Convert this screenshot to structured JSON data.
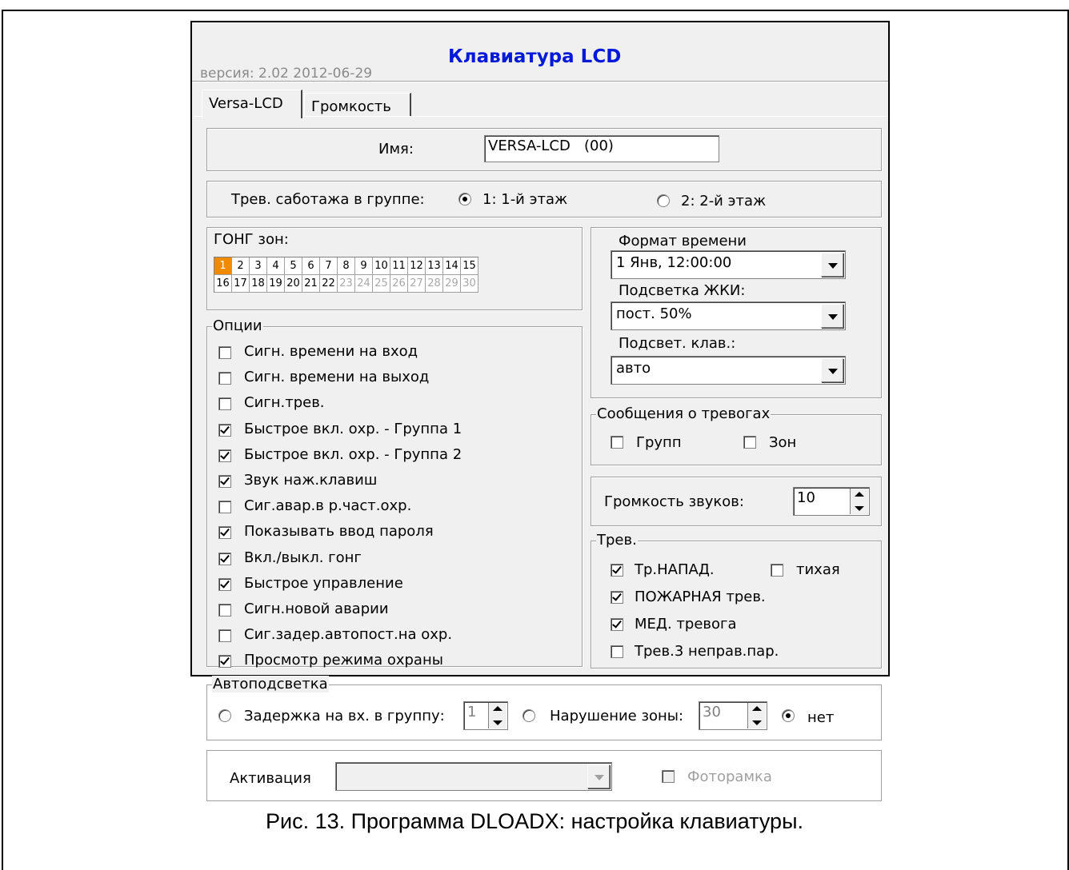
{
  "window": {
    "version": "версия: 2.02 2012-06-29",
    "title": "Клавиатура LCD",
    "tabs": [
      "Versa-LCD",
      "Громкость"
    ]
  },
  "name": {
    "label": "Имя:",
    "value": "VERSA-LCD   (00)"
  },
  "tamper": {
    "label": "Трев. саботажа в группе:",
    "option1": "1: 1-й этаж",
    "option2": "2: 2-й этаж",
    "selected": 1
  },
  "chime": {
    "title": "ГОНГ зон:",
    "zones": [
      "1",
      "2",
      "3",
      "4",
      "5",
      "6",
      "7",
      "8",
      "9",
      "10",
      "11",
      "12",
      "13",
      "14",
      "15",
      "16",
      "17",
      "18",
      "19",
      "20",
      "21",
      "22",
      "23",
      "24",
      "25",
      "26",
      "27",
      "28",
      "29",
      "30"
    ],
    "selected": "1",
    "enabled_max": 22
  },
  "options": {
    "title": "Опции",
    "items": [
      {
        "label": "Сигн. времени на вход",
        "checked": false
      },
      {
        "label": "Сигн. времени на выход",
        "checked": false
      },
      {
        "label": "Сигн.трев.",
        "checked": false
      },
      {
        "label": "Быстрое вкл. охр. - Группа 1",
        "checked": true
      },
      {
        "label": "Быстрое вкл. охр. - Группа 2",
        "checked": true
      },
      {
        "label": "Звук наж.клавиш",
        "checked": true
      },
      {
        "label": "Сиг.авар.в р.част.охр.",
        "checked": false
      },
      {
        "label": "Показывать ввод пароля",
        "checked": true
      },
      {
        "label": "Вкл./выкл. гонг",
        "checked": true
      },
      {
        "label": "Быстрое управление",
        "checked": true
      },
      {
        "label": "Сигн.новой аварии",
        "checked": false
      },
      {
        "label": "Сиг.задер.автопост.на охр.",
        "checked": false
      },
      {
        "label": "Просмотр режима охраны",
        "checked": true
      }
    ]
  },
  "format": {
    "time_label": "Формат времени",
    "time_value": "1 Янв, 12:00:00",
    "lcd_label": "Подсветка ЖКИ:",
    "lcd_value": "пост. 50%",
    "keys_label": "Подсвет. клав.:",
    "keys_value": "авто"
  },
  "alarm_msgs": {
    "title": "Сообщения о тревогах",
    "groups": "Групп",
    "zones": "Зон"
  },
  "volume": {
    "label": "Громкость звуков:",
    "value": "10"
  },
  "alarms": {
    "title": "Трев.",
    "panic": "Тр.НАПАД.",
    "silent": "тихая",
    "fire": "ПОЖАРНАЯ трев.",
    "medical": "МЕД. тревога",
    "wrong_code": "Трев.3 неправ.пар."
  },
  "autobacklight": {
    "title": "Автоподсветка",
    "delay_label": "Задержка на вх. в группу:",
    "delay_value": "1",
    "zone_label": "Нарушение зоны:",
    "zone_value": "30",
    "none_label": "нет"
  },
  "activation": {
    "label": "Активация",
    "photo_label": "Фоторамка"
  },
  "caption": "Рис. 13. Программа DLOADX: настройка клавиатуры."
}
